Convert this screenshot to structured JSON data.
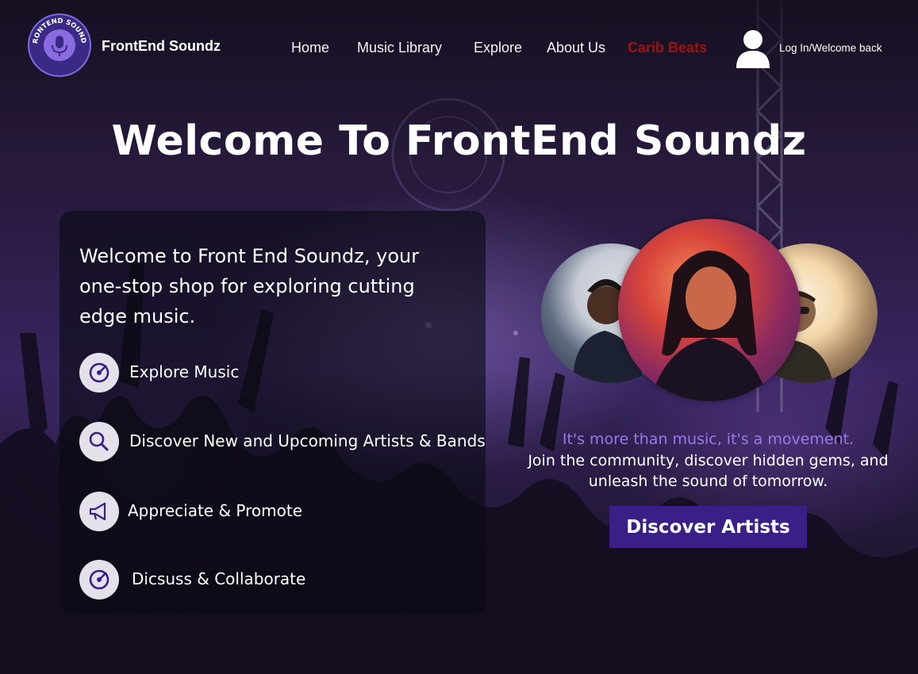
{
  "brand": {
    "name": "FrontEnd Soundz",
    "logo_ring_text": "FRONTEND SOUNDZ"
  },
  "nav": {
    "items": [
      {
        "label": "Home",
        "active": false
      },
      {
        "label": "Music Library",
        "active": false
      },
      {
        "label": "Explore",
        "active": false
      },
      {
        "label": "About Us",
        "active": false
      },
      {
        "label": "Carib Beats",
        "active": true
      }
    ],
    "login_label": "Log In/Welcome back"
  },
  "hero": {
    "title": "Welcome To FrontEnd Soundz"
  },
  "panel": {
    "intro": "Welcome to Front End Soundz, your one-stop shop for exploring cutting edge music.",
    "features": [
      {
        "icon": "vinyl-icon",
        "label": "Explore Music"
      },
      {
        "icon": "search-icon",
        "label": "Discover New and Upcoming Artists & Bands"
      },
      {
        "icon": "megaphone-icon",
        "label": "Appreciate & Promote"
      },
      {
        "icon": "vinyl-icon",
        "label": "Dicsuss & Collaborate"
      }
    ]
  },
  "community": {
    "tagline": "It's more than music, it's a movement.",
    "subtext": "Join the community, discover hidden gems, and unleash the sound of tomorrow.",
    "cta_label": "Discover Artists"
  },
  "colors": {
    "accent_purple": "#3a1f86",
    "tagline_purple": "#9a7be6",
    "active_nav": "#9b1515"
  }
}
